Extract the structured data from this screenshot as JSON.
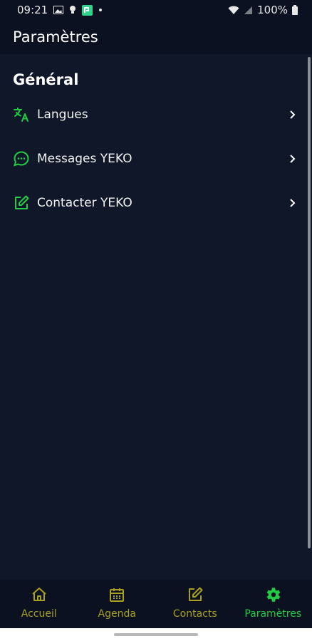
{
  "status_bar": {
    "time": "09:21",
    "battery": "100%",
    "left_icons": [
      "image-icon",
      "lightbulb-icon",
      "app-notification-icon",
      "dot-icon"
    ],
    "right_icons": [
      "wifi-icon",
      "signal-icon",
      "battery-icon"
    ]
  },
  "header": {
    "title": "Paramètres"
  },
  "section": {
    "title": "Général"
  },
  "items": [
    {
      "label": "Langues",
      "icon": "translate-icon"
    },
    {
      "label": "Messages YEKO",
      "icon": "chat-bubble-icon"
    },
    {
      "label": "Contacter YEKO",
      "icon": "edit-square-icon"
    }
  ],
  "bottom_nav": [
    {
      "label": "Accueil",
      "icon": "home-icon",
      "active": false
    },
    {
      "label": "Agenda",
      "icon": "calendar-icon",
      "active": false
    },
    {
      "label": "Contacts",
      "icon": "edit-square-icon",
      "active": false
    },
    {
      "label": "Paramètres",
      "icon": "gear-icon",
      "active": true
    }
  ],
  "colors": {
    "background": "#0f1729",
    "bar_background": "#0b1120",
    "accent_green": "#22cc44",
    "inactive_nav": "#a9a020",
    "text": "#ffffff"
  }
}
